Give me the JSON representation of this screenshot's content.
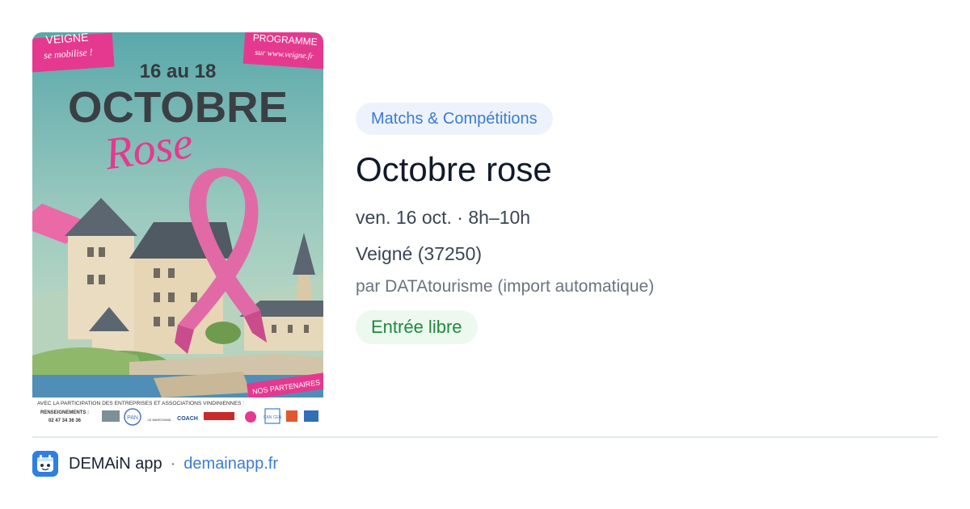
{
  "poster": {
    "corner_left_top": "VEIGNE",
    "corner_left_bottom": "se mobilise !",
    "corner_right_top": "PROGRAMME",
    "corner_right_bottom": "sur www.veigne.fr",
    "dates": "16 au 18",
    "headline": "OCTOBRE",
    "script_word": "Rose",
    "partners_tag": "NOS PARTENAIRES",
    "participation": "AVEC LA PARTICIPATION DES ENTREPRISES ET ASSOCIATIONS VINDINIENNES :",
    "info_label": "RENSEIGNEMENTS :",
    "info_phone": "02 47 34 36 36",
    "logos": [
      "PAN",
      "LE MARCHAND",
      "COACH",
      "CAN CEN"
    ]
  },
  "event": {
    "category": "Matchs & Compétitions",
    "title": "Octobre rose",
    "date": "ven. 16 oct. · 8h–10h",
    "place": "Veigné (37250)",
    "source": "par DATAtourisme (import automatique)",
    "price": "Entrée libre"
  },
  "footer": {
    "app_name": "DEMAiN app",
    "separator": "·",
    "link": "demainapp.fr"
  },
  "colors": {
    "category_chip_bg": "#eef3fb",
    "category_chip_text": "#3a7bd5",
    "price_chip_bg": "#edf8ef",
    "price_chip_text": "#1e8a3e",
    "link": "#3a7bd5",
    "poster_pink": "#e5398f",
    "poster_sky": "#6fb5b5"
  },
  "icons": {
    "app_logo": "demain-app-logo-icon",
    "ribbon": "pink-ribbon-icon"
  }
}
